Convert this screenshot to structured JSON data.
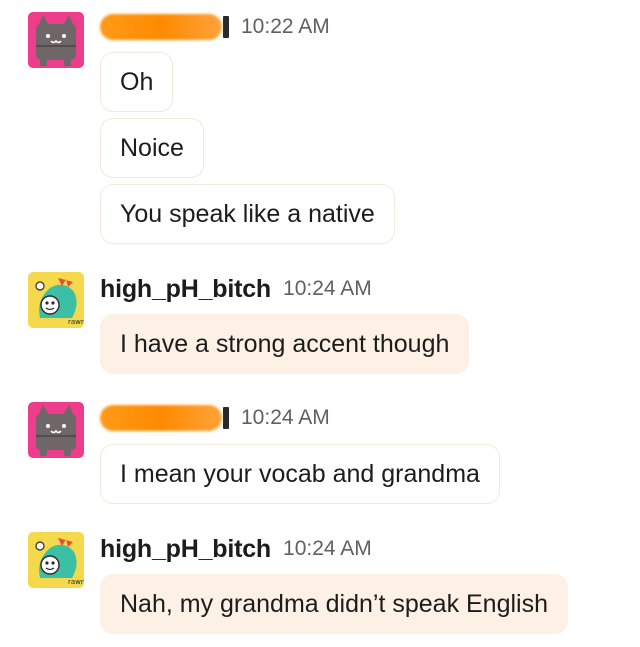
{
  "messages": [
    {
      "sender": "",
      "time": "10:22 AM",
      "avatar_icon": "pink-cat-avatar-icon",
      "lines": [
        "Oh",
        "Noice",
        "You speak like a native"
      ]
    },
    {
      "sender": "high_pH_bitch",
      "time": "10:24 AM",
      "avatar_icon": "green-dino-avatar-icon",
      "lines": [
        "I have a strong accent though"
      ]
    },
    {
      "sender": "",
      "time": "10:24 AM",
      "avatar_icon": "pink-cat-avatar-icon",
      "lines": [
        "I mean your vocab and grandma"
      ]
    },
    {
      "sender": "high_pH_bitch",
      "time": "10:24 AM",
      "avatar_icon": "green-dino-avatar-icon",
      "lines": [
        "Nah, my grandma didn’t speak English"
      ]
    }
  ],
  "colors": {
    "redaction": "#ff8a00",
    "bubble_tint": "#fdf0e4",
    "bubble_border": "#f3e9dc",
    "cat_avatar_bg": "#ee3d8a",
    "dino_avatar_bg": "#f3d94b"
  }
}
